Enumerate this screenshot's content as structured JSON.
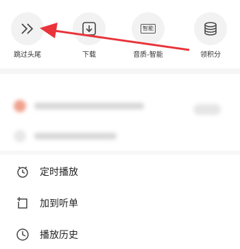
{
  "actions": [
    {
      "label": "跳过头尾",
      "icon": "skip-icon"
    },
    {
      "label": "下载",
      "icon": "download-icon"
    },
    {
      "label": "音质-智能",
      "icon": "quality-icon",
      "badge": "智能"
    },
    {
      "label": "领积分",
      "icon": "coins-icon"
    }
  ],
  "menu": [
    {
      "label": "定时播放",
      "icon": "timer-icon"
    },
    {
      "label": "加到听单",
      "icon": "add-to-list-icon"
    },
    {
      "label": "播放历史",
      "icon": "history-icon"
    }
  ],
  "colors": {
    "annotation_arrow": "#e8343a"
  }
}
